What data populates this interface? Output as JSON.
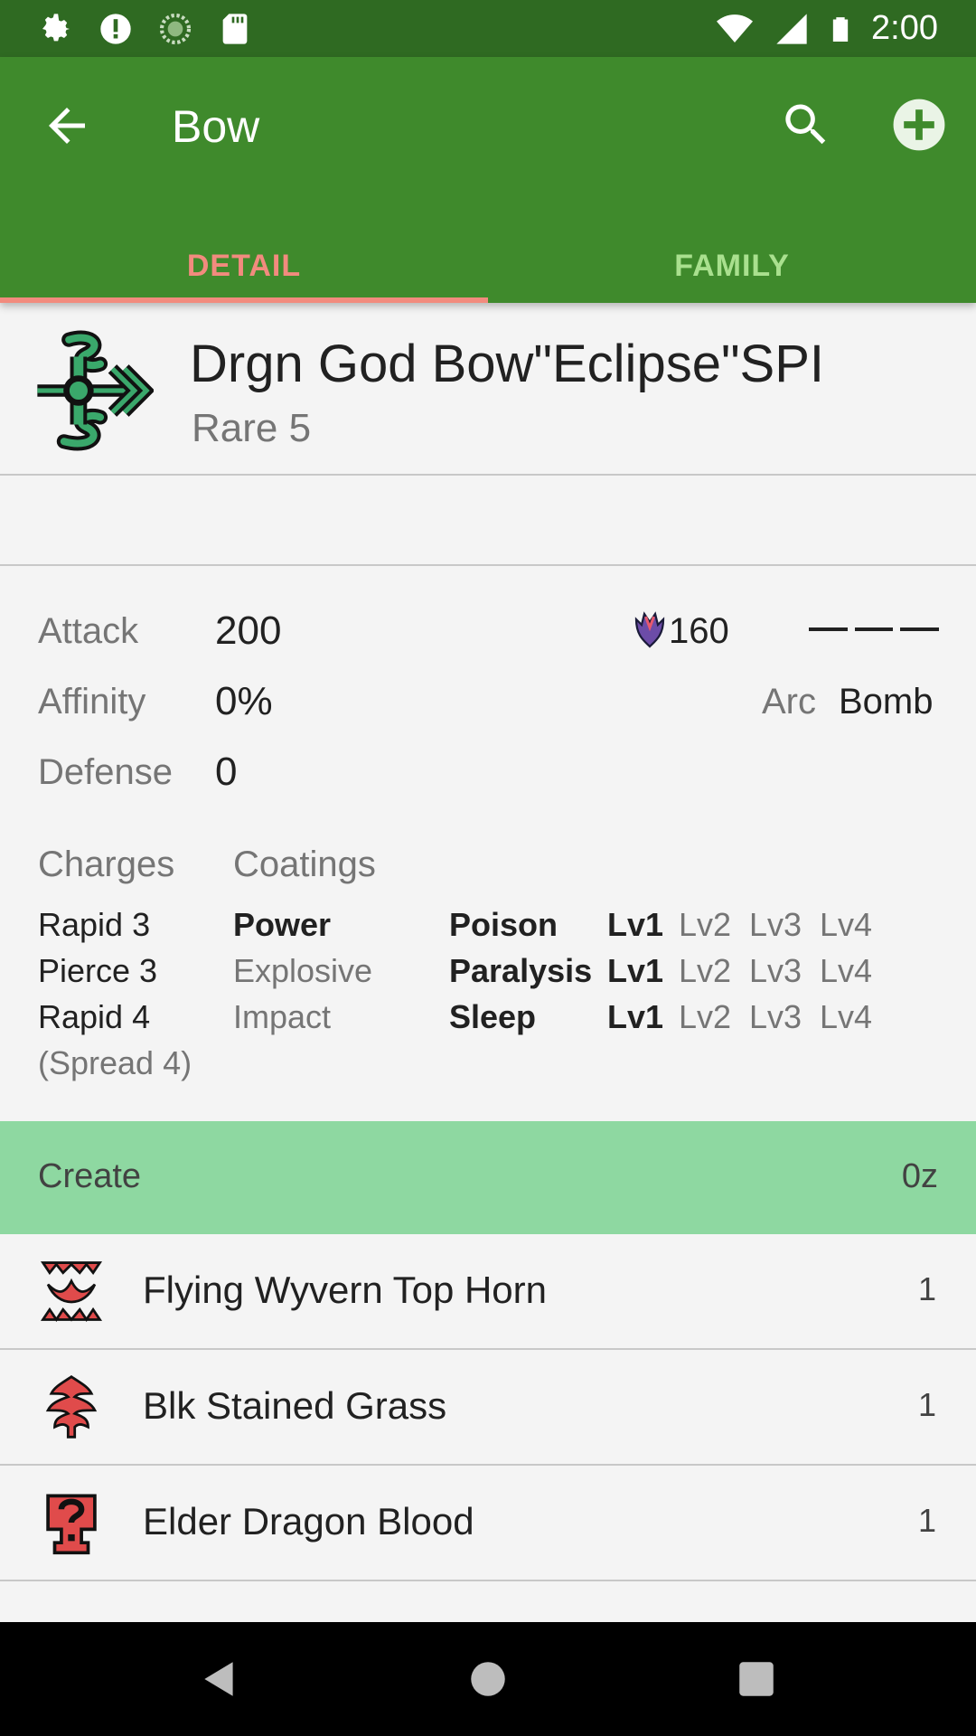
{
  "status_bar": {
    "time": "2:00",
    "left_icons": [
      "settings-icon",
      "alert-icon",
      "sync-icon",
      "sd-card-icon"
    ],
    "right_icons": [
      "wifi-icon",
      "signal-icon",
      "battery-icon"
    ]
  },
  "app_bar": {
    "title": "Bow",
    "back_icon": "arrow-back-icon",
    "search_icon": "search-icon",
    "add_icon": "add-circle-icon",
    "color": "#3f8a2c"
  },
  "tabs": [
    {
      "label": "DETAIL",
      "selected": true
    },
    {
      "label": "FAMILY",
      "selected": false
    }
  ],
  "weapon": {
    "name": "Drgn God Bow\"Eclipse\"SPI",
    "rarity": "Rare 5",
    "icon": "bow-weapon-icon"
  },
  "stats": {
    "attack_label": "Attack",
    "attack_value": "200",
    "affinity_label": "Affinity",
    "affinity_value": "0%",
    "defense_label": "Defense",
    "defense_value": "0",
    "element_icon": "dragon-element-icon",
    "element_value": "160",
    "arc_label": "Arc",
    "arc_value": "Bomb"
  },
  "charges": {
    "label": "Charges",
    "items": [
      "Rapid 3",
      "Pierce 3",
      "Rapid 4",
      "(Spread 4)"
    ]
  },
  "coatings": {
    "label": "Coatings",
    "basic": [
      {
        "name": "Power",
        "enabled": true
      },
      {
        "name": "Explosive",
        "enabled": false
      },
      {
        "name": "Impact",
        "enabled": false
      }
    ],
    "status": [
      {
        "name": "Poison",
        "levels": [
          "Lv1",
          "Lv2",
          "Lv3",
          "Lv4"
        ],
        "enabled_level": "Lv1"
      },
      {
        "name": "Paralysis",
        "levels": [
          "Lv1",
          "Lv2",
          "Lv3",
          "Lv4"
        ],
        "enabled_level": "Lv1"
      },
      {
        "name": "Sleep",
        "levels": [
          "Lv1",
          "Lv2",
          "Lv3",
          "Lv4"
        ],
        "enabled_level": "Lv1"
      }
    ]
  },
  "create": {
    "label": "Create",
    "cost": "0z",
    "color": "#8ed8a1"
  },
  "materials": [
    {
      "name": "Flying Wyvern Top Horn",
      "qty": "1",
      "icon": "horn-material-icon"
    },
    {
      "name": "Blk Stained Grass",
      "qty": "1",
      "icon": "grass-material-icon"
    },
    {
      "name": "Elder Dragon Blood",
      "qty": "1",
      "icon": "blood-material-icon"
    }
  ],
  "nav_bar": {
    "icons": [
      "nav-back-icon",
      "nav-home-icon",
      "nav-recents-icon"
    ]
  }
}
